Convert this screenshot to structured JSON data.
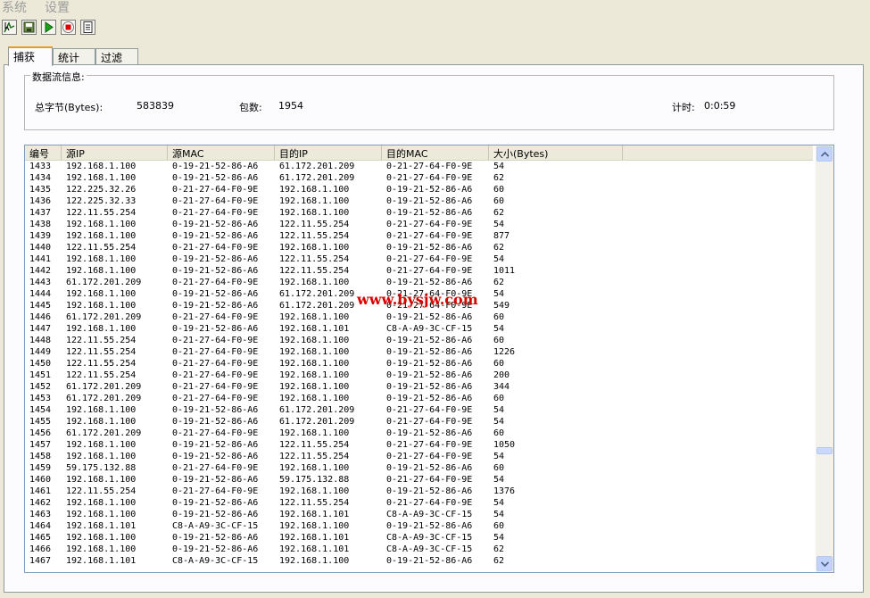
{
  "menu": {
    "items": [
      "系统",
      "设置"
    ]
  },
  "toolbar": {
    "buttons": [
      "capture-icon",
      "save-icon",
      "play-icon",
      "stop-icon",
      "document-icon"
    ]
  },
  "tabs": [
    "捕获",
    "统计",
    "过滤"
  ],
  "stats": {
    "group_title": "数据流信息:",
    "total_bytes_label": "总字节(Bytes):",
    "total_bytes_value": "583839",
    "packets_label": "包数:",
    "packets_value": "1954",
    "timer_label": "计时:",
    "timer_value": "0:0:59"
  },
  "table": {
    "columns": [
      "编号",
      "源IP",
      "源MAC",
      "目的IP",
      "目的MAC",
      "大小(Bytes)",
      ""
    ],
    "rows": [
      [
        "1433",
        "192.168.1.100",
        "0-19-21-52-86-A6",
        "61.172.201.209",
        "0-21-27-64-F0-9E",
        "54"
      ],
      [
        "1434",
        "192.168.1.100",
        "0-19-21-52-86-A6",
        "61.172.201.209",
        "0-21-27-64-F0-9E",
        "62"
      ],
      [
        "1435",
        "122.225.32.26",
        "0-21-27-64-F0-9E",
        "192.168.1.100",
        "0-19-21-52-86-A6",
        "60"
      ],
      [
        "1436",
        "122.225.32.33",
        "0-21-27-64-F0-9E",
        "192.168.1.100",
        "0-19-21-52-86-A6",
        "60"
      ],
      [
        "1437",
        "122.11.55.254",
        "0-21-27-64-F0-9E",
        "192.168.1.100",
        "0-19-21-52-86-A6",
        "62"
      ],
      [
        "1438",
        "192.168.1.100",
        "0-19-21-52-86-A6",
        "122.11.55.254",
        "0-21-27-64-F0-9E",
        "54"
      ],
      [
        "1439",
        "192.168.1.100",
        "0-19-21-52-86-A6",
        "122.11.55.254",
        "0-21-27-64-F0-9E",
        "877"
      ],
      [
        "1440",
        "122.11.55.254",
        "0-21-27-64-F0-9E",
        "192.168.1.100",
        "0-19-21-52-86-A6",
        "62"
      ],
      [
        "1441",
        "192.168.1.100",
        "0-19-21-52-86-A6",
        "122.11.55.254",
        "0-21-27-64-F0-9E",
        "54"
      ],
      [
        "1442",
        "192.168.1.100",
        "0-19-21-52-86-A6",
        "122.11.55.254",
        "0-21-27-64-F0-9E",
        "1011"
      ],
      [
        "1443",
        "61.172.201.209",
        "0-21-27-64-F0-9E",
        "192.168.1.100",
        "0-19-21-52-86-A6",
        "62"
      ],
      [
        "1444",
        "192.168.1.100",
        "0-19-21-52-86-A6",
        "61.172.201.209",
        "0-21-27-64-F0-9E",
        "54"
      ],
      [
        "1445",
        "192.168.1.100",
        "0-19-21-52-86-A6",
        "61.172.201.209",
        "0-21-27-64-F0-9E",
        "549"
      ],
      [
        "1446",
        "61.172.201.209",
        "0-21-27-64-F0-9E",
        "192.168.1.100",
        "0-19-21-52-86-A6",
        "60"
      ],
      [
        "1447",
        "192.168.1.100",
        "0-19-21-52-86-A6",
        "192.168.1.101",
        "C8-A-A9-3C-CF-15",
        "54"
      ],
      [
        "1448",
        "122.11.55.254",
        "0-21-27-64-F0-9E",
        "192.168.1.100",
        "0-19-21-52-86-A6",
        "60"
      ],
      [
        "1449",
        "122.11.55.254",
        "0-21-27-64-F0-9E",
        "192.168.1.100",
        "0-19-21-52-86-A6",
        "1226"
      ],
      [
        "1450",
        "122.11.55.254",
        "0-21-27-64-F0-9E",
        "192.168.1.100",
        "0-19-21-52-86-A6",
        "60"
      ],
      [
        "1451",
        "122.11.55.254",
        "0-21-27-64-F0-9E",
        "192.168.1.100",
        "0-19-21-52-86-A6",
        "200"
      ],
      [
        "1452",
        "61.172.201.209",
        "0-21-27-64-F0-9E",
        "192.168.1.100",
        "0-19-21-52-86-A6",
        "344"
      ],
      [
        "1453",
        "61.172.201.209",
        "0-21-27-64-F0-9E",
        "192.168.1.100",
        "0-19-21-52-86-A6",
        "60"
      ],
      [
        "1454",
        "192.168.1.100",
        "0-19-21-52-86-A6",
        "61.172.201.209",
        "0-21-27-64-F0-9E",
        "54"
      ],
      [
        "1455",
        "192.168.1.100",
        "0-19-21-52-86-A6",
        "61.172.201.209",
        "0-21-27-64-F0-9E",
        "54"
      ],
      [
        "1456",
        "61.172.201.209",
        "0-21-27-64-F0-9E",
        "192.168.1.100",
        "0-19-21-52-86-A6",
        "60"
      ],
      [
        "1457",
        "192.168.1.100",
        "0-19-21-52-86-A6",
        "122.11.55.254",
        "0-21-27-64-F0-9E",
        "1050"
      ],
      [
        "1458",
        "192.168.1.100",
        "0-19-21-52-86-A6",
        "122.11.55.254",
        "0-21-27-64-F0-9E",
        "54"
      ],
      [
        "1459",
        "59.175.132.88",
        "0-21-27-64-F0-9E",
        "192.168.1.100",
        "0-19-21-52-86-A6",
        "60"
      ],
      [
        "1460",
        "192.168.1.100",
        "0-19-21-52-86-A6",
        "59.175.132.88",
        "0-21-27-64-F0-9E",
        "54"
      ],
      [
        "1461",
        "122.11.55.254",
        "0-21-27-64-F0-9E",
        "192.168.1.100",
        "0-19-21-52-86-A6",
        "1376"
      ],
      [
        "1462",
        "192.168.1.100",
        "0-19-21-52-86-A6",
        "122.11.55.254",
        "0-21-27-64-F0-9E",
        "54"
      ],
      [
        "1463",
        "192.168.1.100",
        "0-19-21-52-86-A6",
        "192.168.1.101",
        "C8-A-A9-3C-CF-15",
        "54"
      ],
      [
        "1464",
        "192.168.1.101",
        "C8-A-A9-3C-CF-15",
        "192.168.1.100",
        "0-19-21-52-86-A6",
        "60"
      ],
      [
        "1465",
        "192.168.1.100",
        "0-19-21-52-86-A6",
        "192.168.1.101",
        "C8-A-A9-3C-CF-15",
        "54"
      ],
      [
        "1466",
        "192.168.1.100",
        "0-19-21-52-86-A6",
        "192.168.1.101",
        "C8-A-A9-3C-CF-15",
        "62"
      ],
      [
        "1467",
        "192.168.1.101",
        "C8-A-A9-3C-CF-15",
        "192.168.1.100",
        "0-19-21-52-86-A6",
        "62"
      ]
    ]
  },
  "watermark": "www.bysjw.com",
  "colors": {
    "window_bg": "#ece9d8",
    "tab_accent": "#e89b22",
    "watermark": "#d80000",
    "scroll_button": "#c1d3fb"
  }
}
